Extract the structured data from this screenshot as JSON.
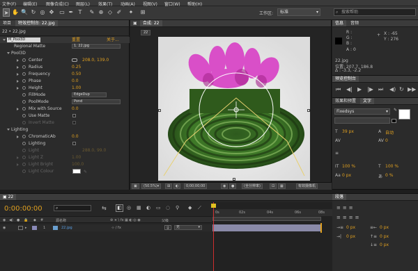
{
  "menu": [
    "文件(F)",
    "编辑(E)",
    "图像合成(C)",
    "图层(L)",
    "效果(T)",
    "动画(A)",
    "视图(V)",
    "窗口(W)",
    "帮助(H)"
  ],
  "toolbar": {
    "workspace_label": "工作区:",
    "workspace_value": "标准",
    "search_placeholder": "搜索帮助"
  },
  "project_panel": {
    "tab_project": "项目",
    "tab_effect_controls": "特效控制台: 22.jpg"
  },
  "effect_controls": {
    "breadcrumb": "22 • 22.jpg",
    "effect_name": "M_Pool3D",
    "effect_reset": "重置",
    "effect_about": "关于...",
    "regional_matte_label": "Regional Matte",
    "regional_matte_value": "1. 22.jpg",
    "group_pool": "Pool3D",
    "params": [
      {
        "name": "Center",
        "value": "208.0, 139.0"
      },
      {
        "name": "Radius",
        "value": "0.25"
      },
      {
        "name": "Frequency",
        "value": "0.50"
      },
      {
        "name": "Phase",
        "value": "0.0"
      },
      {
        "name": "Height",
        "value": "1.00"
      },
      {
        "name": "FillMode",
        "value": "EdgeDup"
      },
      {
        "name": "PoolMode",
        "value": "Pond"
      },
      {
        "name": "Mix with Source",
        "value": "0.0"
      },
      {
        "name": "Use Matte",
        "value": ""
      },
      {
        "name": "Invert Matte",
        "value": ""
      }
    ],
    "group_lighting": "Lighting",
    "lighting_params": [
      {
        "name": "ChromaticAb",
        "value": "0.0"
      },
      {
        "name": "Lighting",
        "value": ""
      },
      {
        "name": "Light",
        "value": "288.0, 99.0"
      },
      {
        "name": "Light Z",
        "value": "1.00"
      },
      {
        "name": "Light Bright",
        "value": "100.0"
      },
      {
        "name": "Light Colour",
        "value": ""
      }
    ]
  },
  "composition": {
    "tab": "合成: 22",
    "sub_tab": "22",
    "zoom": "50.5",
    "timecode": "0;00;00;00",
    "resolution": "(全分辨率)",
    "camera": "有效摄像机"
  },
  "info_panel": {
    "tab_info": "信息",
    "tab_audio": "音频",
    "r": "R :",
    "g": "G :",
    "b": "B :",
    "a": "A : 0",
    "x": "X : -65",
    "y": "Y : 276",
    "file": "22.jpg",
    "position": "位置: 207.7, 186.8",
    "delta": "Δ : -3.3, -2.2"
  },
  "preview_panel": {
    "tab": "预览控制台"
  },
  "effects_panel": {
    "tab_effects": "效果和预置",
    "tab_char": "文字",
    "font": "Fixedsys",
    "size": "39 px",
    "leading": "自动",
    "kern": "0",
    "track": "0",
    "vscale": "100 %",
    "hscale": "100 %",
    "baseline": "0 px",
    "tsume": "0 %"
  },
  "timeline": {
    "tab": "22",
    "timecode": "0:00:00:00",
    "search_placeholder": "",
    "col_source": "源名称",
    "col_parent": "父级",
    "layer_num": "1",
    "layer_name": "22.jpg",
    "layer_parent": "无",
    "ruler": [
      "0s",
      "02s",
      "04s",
      "06s",
      "08s"
    ]
  },
  "paragraph_panel": {
    "tab": "段落",
    "v1": "0 px",
    "v2": "0 px",
    "v3": "0 px",
    "v4": "0 px",
    "v5": "0 px"
  },
  "colors": {
    "accent": "#e0a020",
    "bg": "#2b2b2b"
  }
}
